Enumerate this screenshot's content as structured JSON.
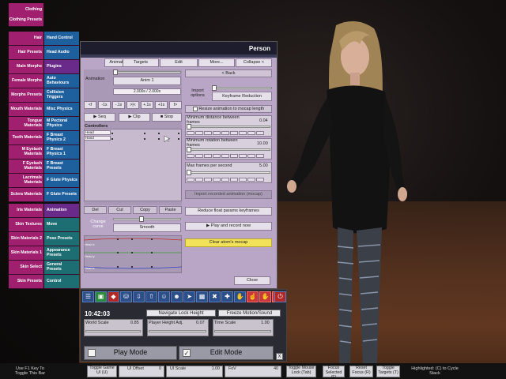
{
  "app": {
    "panel_title": "Person"
  },
  "colors": {
    "magenta": "#a0206f",
    "blue": "#1e5f9e",
    "teal": "#1d6e73",
    "panel_bg": "#b9a5c6",
    "dock_bg": "#2a2a33",
    "accent_yellow": "#f2e25a"
  },
  "left_tabs": [
    "Clothing",
    "Clothing Presets",
    "Hair",
    "Hair Presets",
    "Main Morphs",
    "Female Morphs",
    "Morphs Presets",
    "Mouth Materials",
    "Tongue Materials",
    "Teeth Materials",
    "M Eyelash Materials",
    "F Eyelash Materials",
    "Lacrimals Materials",
    "Sclera Materials",
    "Iris Materials",
    "Skin Textures",
    "Skin Materials 2",
    "Skin Materials 1",
    "Skin Select",
    "Skin Presets"
  ],
  "right_tabs": [
    "Hand Control",
    "Head Audio",
    "Plugins",
    "Auto Behaviours",
    "Collision Triggers",
    "Misc Physics",
    "M Pectoral Physics",
    "F Breast Physics 2",
    "F Breast Physics 1",
    "F Breast Presets",
    "F Glute Physics",
    "F Glute Presets",
    "Animation",
    "Move",
    "Pose Presets",
    "Appearance Presets",
    "General Presets",
    "Control"
  ],
  "top_tabs": [
    "Animations",
    "Targets",
    "Edit",
    "More...",
    "Collapse <"
  ],
  "animation": {
    "label": "Animation",
    "name": "Anim 1",
    "time": "2.000s / 2.000s",
    "step_buttons": [
      "<f",
      "-1s",
      "-.1s",
      ">|<",
      "+.1s",
      "+1s",
      "f>"
    ],
    "seq_label": "▶ Seq",
    "clip_label": "▶ Clip",
    "stop_label": "■ Stop",
    "controllers_label": "Controllers",
    "controllers": [
      "Head",
      "Hand"
    ],
    "edit_buttons": [
      "Del",
      "Cut",
      "Copy",
      "Paste"
    ],
    "change_curve": "Change curve",
    "curve_value": "Smooth",
    "curve_labels": [
      "Head x",
      "Head y",
      "Head z"
    ]
  },
  "import": {
    "back": "< Back",
    "options_label": "Import options",
    "keyframe_reduction": "Keyframe Reduction",
    "resize_label": "Resize animation to mocap length",
    "min_distance_label": "Minimum distance between frames",
    "min_distance_value": "0.04",
    "min_rotation_label": "Minimum rotation between frames",
    "min_rotation_value": "10.00",
    "max_fps_label": "Max frames per second",
    "max_fps_value": "5.00",
    "import_button": "Import recorded animation (mocap)",
    "reduce_button": "Reduce float params keyframes",
    "play_record": "▶ Play and record now",
    "clear_mocap": "Clear atom's mocap",
    "close": "Close"
  },
  "dock": {
    "time": "10:42:03",
    "navigate_lock": "Navigate Lock Height",
    "freeze_motion": "Freeze Motion/Sound",
    "world_scale_label": "World Scale",
    "world_scale_value": "0.85",
    "player_height_label": "Player Height Adj.",
    "player_height_value": "0.07",
    "time_scale_label": "Time Scale",
    "time_scale_value": "1.00",
    "play_mode": "Play Mode",
    "edit_mode": "Edit Mode",
    "edit_checked": "✓",
    "close_x": "X"
  },
  "status": {
    "hint": "Use F1 Key To Toggle This Bar",
    "toggle_game_ui": "Toggle Game UI (U)",
    "ui_offset_label": "UI Offset",
    "ui_offset_value": "0",
    "ui_scale_label": "UI Scale",
    "ui_scale_value": "1.00",
    "fov_label": "FoV",
    "fov_value": "40",
    "toggle_mouse_lock": "Toggle Mouse Lock (Tab)",
    "focus_selected": "Focus Selected (F)",
    "reset_focus": "Reset Focus (R)",
    "toggle_targets": "Toggle Targets (T)",
    "highlighted": "Highlighted: (C) to Cycle Stack"
  }
}
